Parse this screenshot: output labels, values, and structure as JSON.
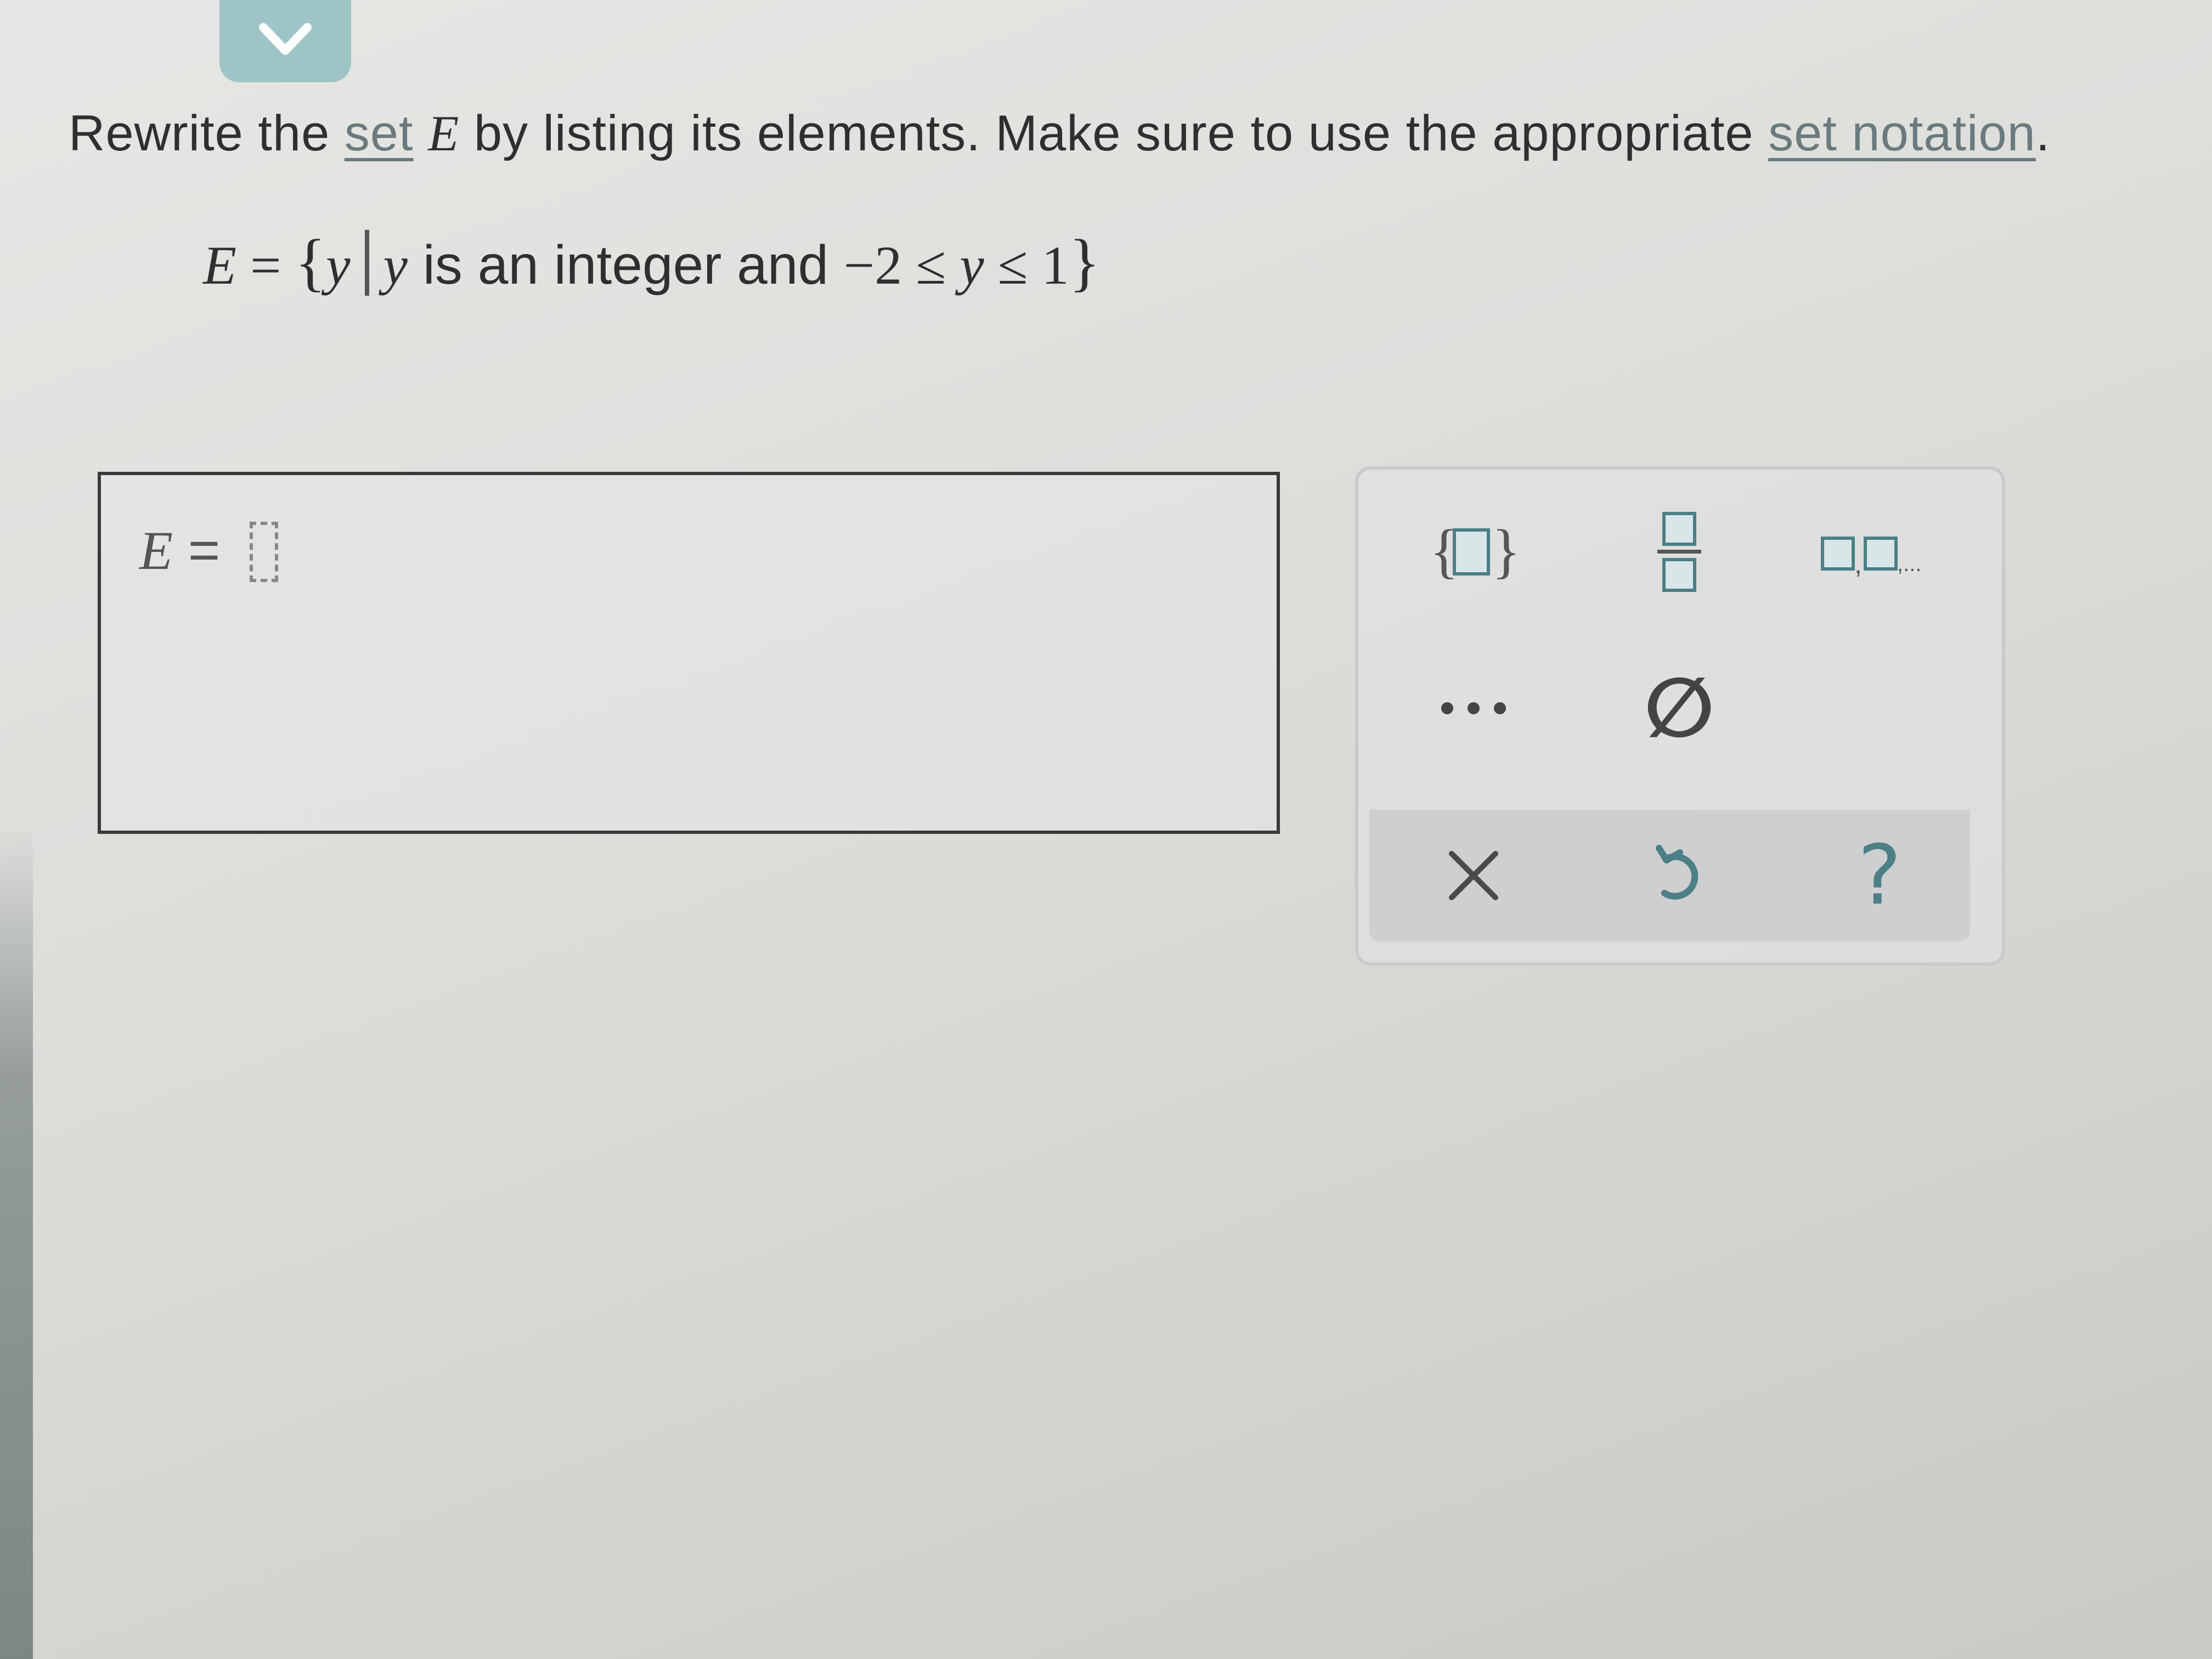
{
  "question": {
    "part1": "Rewrite the ",
    "link_set": "set",
    "var_E": "E",
    "part2": " by listing its elements. Make sure to use the appropriate ",
    "link_notation": "set notation",
    "end": "."
  },
  "set_definition": {
    "lhs": "E",
    "equals": " = ",
    "open_brace": "{",
    "var": "y",
    "var2": "y",
    "condition": " is an integer and ",
    "lower": "−2",
    "le1": " ≤ ",
    "var3": "y",
    "le2": " ≤ ",
    "upper": "1",
    "close_brace": "}"
  },
  "answer": {
    "lhs": "E",
    "equals": " = "
  },
  "palette": {
    "buttons": [
      "set-braces",
      "fraction",
      "list",
      "ellipsis",
      "empty-set",
      "clear",
      "undo",
      "help"
    ],
    "empty_set_symbol": "∅",
    "help_symbol": "?",
    "ellipsis_symbol": "...",
    "list_suffix": ",..."
  },
  "colors": {
    "accent": "#4c7f86",
    "chevron_bg": "#9fc4c6",
    "link": "#6a7a7e"
  }
}
